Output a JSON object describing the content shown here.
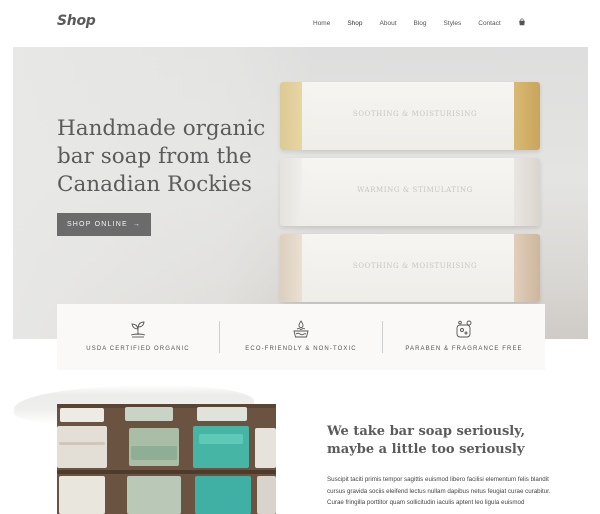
{
  "header": {
    "logo": "Shop",
    "nav": [
      {
        "label": "Home"
      },
      {
        "label": "Shop"
      },
      {
        "label": "About"
      },
      {
        "label": "Blog"
      },
      {
        "label": "Styles"
      },
      {
        "label": "Contact"
      }
    ],
    "cart_icon": "shopping-bag-icon"
  },
  "hero": {
    "title": "Handmade organic bar soap from the Canadian Rockies",
    "button_label": "SHOP ONLINE",
    "button_arrow": "→",
    "soap_stamps": [
      "SOOTHING & MOISTURISING",
      "WARMING & STIMULATING",
      "SOOTHING & MOISTURISING"
    ]
  },
  "features": [
    {
      "label": "USDA CERTIFIED ORGANIC",
      "icon": "sprout-icon"
    },
    {
      "label": "ECO-FRIENDLY & NON-TOXIC",
      "icon": "water-leaf-icon"
    },
    {
      "label": "PARABEN & FRAGRANCE FREE",
      "icon": "soap-bubbles-icon"
    }
  ],
  "about": {
    "title": "We take bar soap seriously, maybe a little too seriously",
    "body": "Suscipit taciti primis tempor sagittis euismod libero facilisi elementum felis blandit cursus gravida sociis eleifend lectus nullam dapibus netus feugiat curae curabitur. Curae fringilla porttitor quam sollicitudin iaculis aptent leo ligula euismod"
  },
  "colors": {
    "button_bg": "#6b6b6b",
    "text": "#5b5b5b",
    "feature_bg": "#faf9f7"
  }
}
